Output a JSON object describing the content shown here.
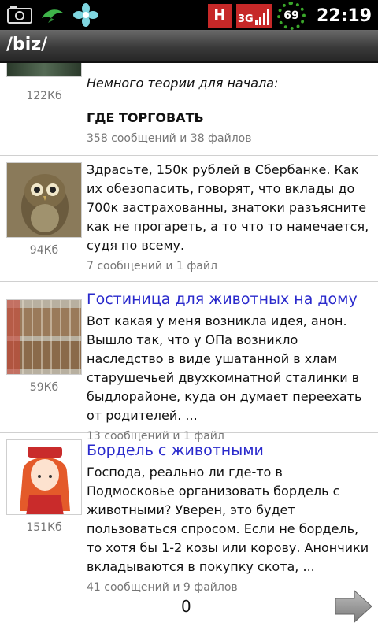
{
  "statusbar": {
    "battery_percent": "69",
    "time": "22:19",
    "network": "3G",
    "h_label": "H"
  },
  "title": "/biz/",
  "threads": [
    {
      "size": "122Кб",
      "subject": "",
      "body_italic": "Немного теории для начала:",
      "body_heading": "ГДЕ ТОРГОВАТЬ",
      "meta": "358 сообщений и 38 файлов"
    },
    {
      "size": "94Кб",
      "subject": "",
      "body": "Здрасьте, 150к рублей в Сбербанке. Как их обезопасить, говорят, что вклады до 700к застрахованны, знатоки разъясните как не прогареть, а то что то намечается, судя по всему.",
      "meta": "7 сообщений и 1 файл"
    },
    {
      "size": "59Кб",
      "subject": "Гостиница для животных на дому",
      "body": "Вот какая у меня возникла идея, анон. Вышло так, что у ОПа возникло наследство в виде ушатанной в хлам старушечьей двухкомнатной сталинки в быдлорайоне, куда он думает переехать от родителей. ...",
      "meta": "13 сообщений и 1 файл"
    },
    {
      "size": "151Кб",
      "subject": "Бордель с животными",
      "body": "Господа, реально ли где-то в Подмосковье организовать бордель с животными? Уверен, это будет пользоваться спросом. Если не бордель, то хотя бы 1-2 козы или корову. Анончики вкладываются в покупку скота, ...",
      "meta": "41 сообщений и 9 файлов"
    }
  ],
  "footer": {
    "page_number": "0"
  }
}
